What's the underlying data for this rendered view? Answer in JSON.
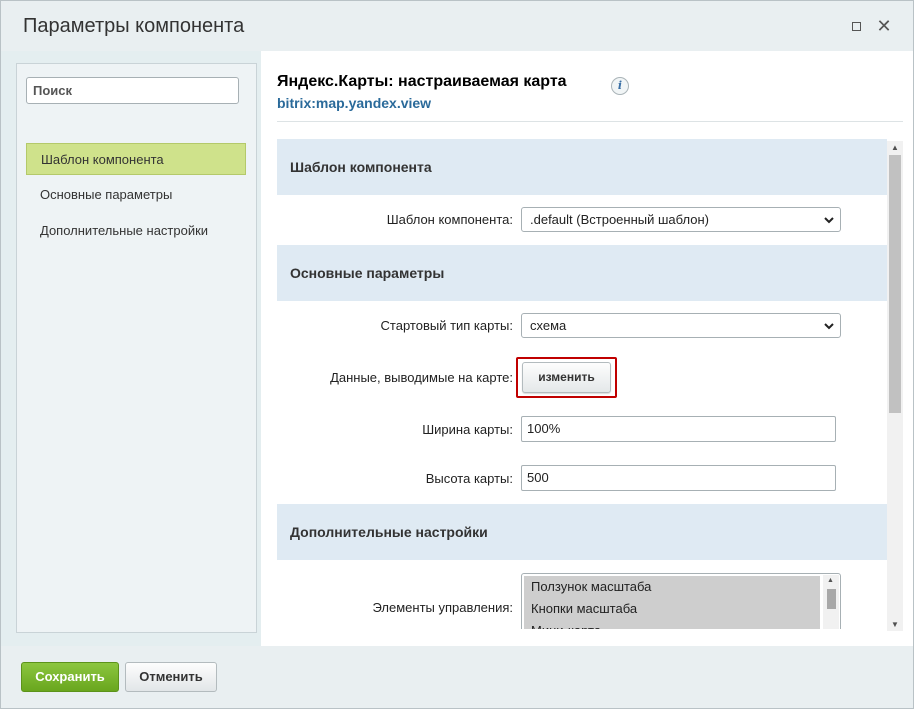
{
  "window": {
    "title": "Параметры компонента"
  },
  "sidebar": {
    "search_placeholder": "Поиск",
    "items": [
      {
        "label": "Шаблон компонента",
        "active": true
      },
      {
        "label": "Основные параметры",
        "active": false
      },
      {
        "label": "Дополнительные настройки",
        "active": false
      }
    ]
  },
  "component": {
    "title": "Яндекс.Карты: настраиваемая карта",
    "code": "bitrix:map.yandex.view",
    "info_icon_glyph": "i"
  },
  "sections": {
    "template": {
      "heading": "Шаблон компонента",
      "template_label": "Шаблон компонента:",
      "template_value": ".default (Встроенный шаблон)"
    },
    "main": {
      "heading": "Основные параметры",
      "map_type_label": "Стартовый тип карты:",
      "map_type_value": "схема",
      "map_data_label": "Данные, выводимые на карте:",
      "change_button": "изменить",
      "width_label": "Ширина карты:",
      "width_value": "100%",
      "height_label": "Высота карты:",
      "height_value": "500"
    },
    "extra": {
      "heading": "Дополнительные настройки",
      "controls_label": "Элементы управления:",
      "controls_options": [
        "Ползунок масштаба",
        "Кнопки масштаба",
        "Мини-карта"
      ]
    }
  },
  "footer": {
    "save_label": "Сохранить",
    "cancel_label": "Отменить"
  },
  "colors": {
    "accent_green": "#69a61e",
    "active_nav": "#cfe28b",
    "highlight_red": "#c00000",
    "link_blue": "#2a6a9a"
  }
}
